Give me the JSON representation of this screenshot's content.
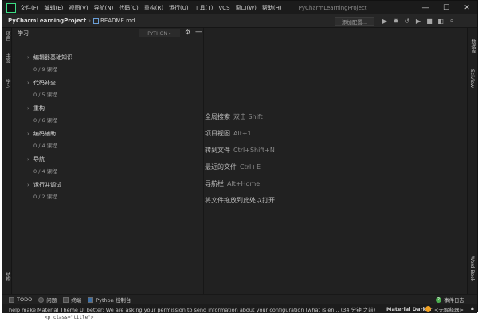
{
  "window": {
    "menu": [
      "文件(F)",
      "编辑(E)",
      "视图(V)",
      "导航(N)",
      "代码(C)",
      "重构(R)",
      "运行(U)",
      "工具(T)",
      "VCS",
      "窗口(W)",
      "帮助(H)"
    ],
    "project_title": "PyCharmLearningProject",
    "controls": {
      "minimize": "—",
      "maximize": "☐",
      "close": "✕"
    }
  },
  "navbar": {
    "project": "PyCharmLearningProject",
    "separator": "›",
    "file": "README.md",
    "add_config": "添加配置...",
    "tool_icons": [
      "▶",
      "✹",
      "↺",
      "▶̶",
      "■",
      "◧",
      "⌕"
    ]
  },
  "left_stripe": {
    "project_tab": "项目",
    "bookmarks_tab": "书签",
    "learn_tab": "学习",
    "structure_tab": "结构"
  },
  "right_stripe": {
    "db_tab": "数据库",
    "sciview_tab": "SciView",
    "word_book_tab": "Word Book"
  },
  "learn_panel": {
    "title": "学习",
    "language": "PYTHON",
    "lessons": [
      {
        "title": "编辑器基础知识",
        "progress": "0 / 9 课程"
      },
      {
        "title": "代码补全",
        "progress": "0 / 5 课程"
      },
      {
        "title": "重构",
        "progress": "0 / 6 课程"
      },
      {
        "title": "编码辅助",
        "progress": "0 / 4 课程"
      },
      {
        "title": "导航",
        "progress": "0 / 4 课程"
      },
      {
        "title": "运行并调试",
        "progress": "0 / 2 课程"
      }
    ]
  },
  "hints": [
    {
      "label": "全局搜索",
      "keys": "双击 Shift"
    },
    {
      "label": "项目视图",
      "keys": "Alt+1"
    },
    {
      "label": "转到文件",
      "keys": "Ctrl+Shift+N"
    },
    {
      "label": "最近的文件",
      "keys": "Ctrl+E"
    },
    {
      "label": "导航栏",
      "keys": "Alt+Home"
    },
    {
      "label": "将文件拖放到此处以打开",
      "keys": ""
    }
  ],
  "bottom_tools": [
    {
      "name": "todo",
      "label": "TODO"
    },
    {
      "name": "problems",
      "label": "问题"
    },
    {
      "name": "terminal",
      "label": "终端"
    },
    {
      "name": "python-console",
      "label": "Python 控制台"
    }
  ],
  "event_log": {
    "label": "事件日志",
    "count": "2"
  },
  "status": {
    "message": "help make Material Theme UI better: We are asking your permission to send information about your configuration (what is en... (34 分钟 之前)",
    "theme": "Material Darker",
    "interpreter": "<无解释器>"
  },
  "below_text": "<p class=\"title\">"
}
